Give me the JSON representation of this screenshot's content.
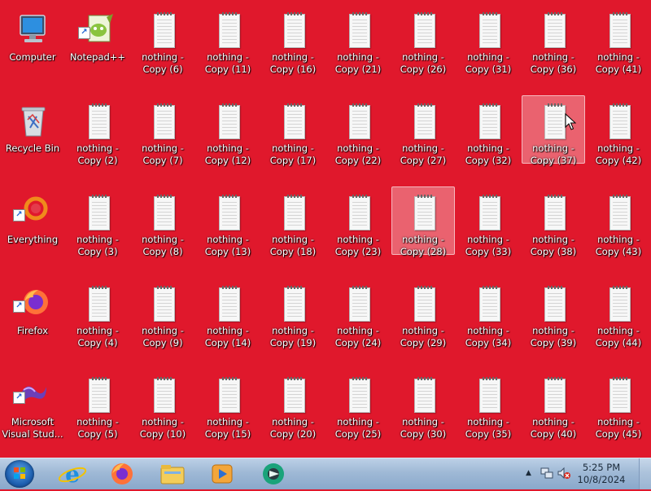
{
  "desktop": {
    "system_icons": [
      {
        "label": "Computer",
        "icon": "computer-icon"
      },
      {
        "label": "Recycle Bin",
        "icon": "recycle-bin-icon"
      },
      {
        "label": "Everything",
        "icon": "everything-icon"
      },
      {
        "label": "Firefox",
        "icon": "firefox-icon"
      },
      {
        "label": "Microsoft\nVisual Stud...",
        "icon": "visual-studio-icon"
      },
      {
        "label": "Notepad++",
        "icon": "notepad-plus-plus-icon"
      }
    ],
    "files": [
      "nothing -\nCopy (2)",
      "nothing -\nCopy (3)",
      "nothing -\nCopy (4)",
      "nothing -\nCopy (5)",
      "nothing -\nCopy (6)",
      "nothing -\nCopy (7)",
      "nothing -\nCopy (8)",
      "nothing -\nCopy (9)",
      "nothing -\nCopy (10)",
      "nothing -\nCopy (11)",
      "nothing -\nCopy (12)",
      "nothing -\nCopy (13)",
      "nothing -\nCopy (14)",
      "nothing -\nCopy (15)",
      "nothing -\nCopy (16)",
      "nothing -\nCopy (17)",
      "nothing -\nCopy (18)",
      "nothing -\nCopy (19)",
      "nothing -\nCopy (20)",
      "nothing -\nCopy (21)",
      "nothing -\nCopy (22)",
      "nothing -\nCopy (23)",
      "nothing -\nCopy (24)",
      "nothing -\nCopy (25)",
      "nothing -\nCopy (26)",
      "nothing -\nCopy (27)",
      "nothing -\nCopy (28)",
      "nothing -\nCopy (29)",
      "nothing -\nCopy (30)",
      "nothing -\nCopy (31)",
      "nothing -\nCopy (32)",
      "nothing -\nCopy (33)",
      "nothing -\nCopy (34)",
      "nothing -\nCopy (35)",
      "nothing -\nCopy (36)",
      "nothing -\nCopy (37)",
      "nothing -\nCopy (38)",
      "nothing -\nCopy (39)",
      "nothing -\nCopy (40)",
      "nothing -\nCopy (41)",
      "nothing -\nCopy (42)",
      "nothing -\nCopy (43)",
      "nothing -\nCopy (44)",
      "nothing -\nCopy (45)"
    ],
    "selected_files": [
      "nothing -\nCopy (28)",
      "nothing -\nCopy (37)"
    ],
    "background_color": "#e0182c"
  },
  "taskbar": {
    "pinned": [
      {
        "icon": "internet-explorer-icon"
      },
      {
        "icon": "firefox-icon"
      },
      {
        "icon": "file-explorer-icon"
      },
      {
        "icon": "media-player-icon"
      },
      {
        "icon": "app-icon"
      }
    ],
    "tray_icons": [
      "show-hidden-icons-arrow-icon",
      "network-icon",
      "volume-muted-icon"
    ],
    "clock": {
      "time": "5:25 PM",
      "date": "10/8/2024"
    }
  }
}
